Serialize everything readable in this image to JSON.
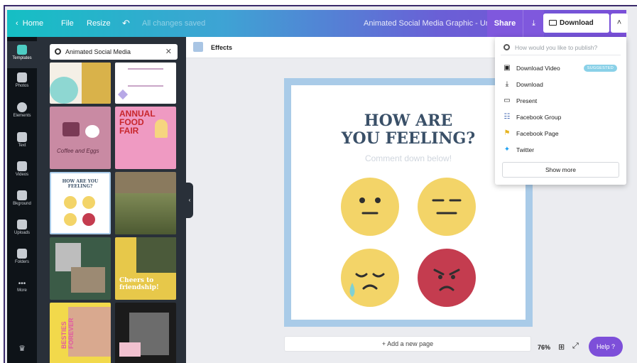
{
  "topbar": {
    "home": "Home",
    "file": "File",
    "resize": "Resize",
    "saved_status": "All changes saved",
    "document_title": "Animated Social Media Graphic - Untitled",
    "share": "Share",
    "download_video": "Download Video"
  },
  "rail": {
    "items": [
      "Templates",
      "Photos",
      "Elements",
      "Text",
      "Videos",
      "Bkground",
      "Uploads",
      "Folders",
      "More"
    ]
  },
  "panel": {
    "search_value": "Animated Social Media",
    "thumbs": {
      "food_fair": "ANNUAL FOOD FAIR",
      "coffee": "Coffee and Eggs",
      "feeling": "HOW ARE YOU FEELING?",
      "friendship": "Cheers to friendship!",
      "besties": "BESTIES FOREVER"
    }
  },
  "editor": {
    "effects": "Effects",
    "card_title_line1": "HOW ARE",
    "card_title_line2": "YOU FEELING?",
    "card_subtitle": "Comment down below!",
    "add_page": "+ Add a new page",
    "zoom": "76%",
    "help": "Help ?"
  },
  "dropdown": {
    "search_placeholder": "How would you like to publish?",
    "items": [
      {
        "label": "Download Video",
        "badge": "SUGGESTED"
      },
      {
        "label": "Download"
      },
      {
        "label": "Present"
      },
      {
        "label": "Facebook Group"
      },
      {
        "label": "Facebook Page"
      },
      {
        "label": "Twitter"
      }
    ],
    "show_more": "Show more"
  },
  "colors": {
    "accent": "#7d4fd9",
    "canvas_border": "#a9cbe8",
    "face_yellow": "#f3d468",
    "face_red": "#c43c4f"
  }
}
